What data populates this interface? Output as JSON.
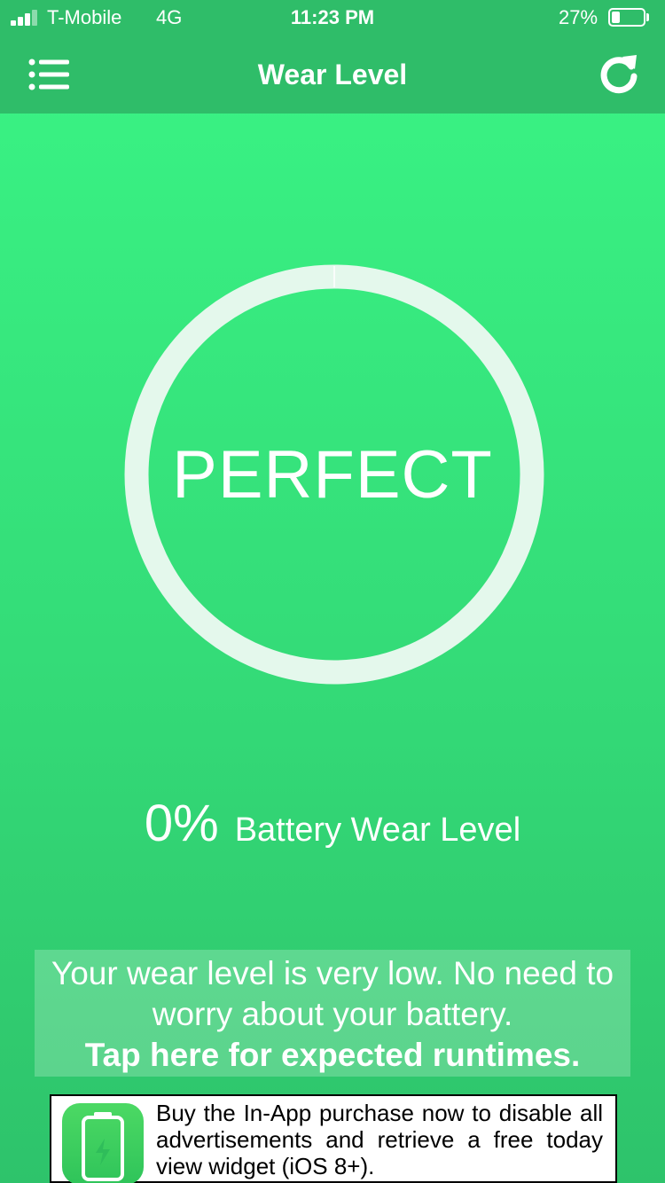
{
  "status_bar": {
    "carrier": "T-Mobile",
    "network": "4G",
    "time": "11:23 PM",
    "battery_percent": "27%",
    "battery_level": 0.27
  },
  "nav": {
    "title": "Wear Level",
    "menu_icon": "list-icon",
    "refresh_icon": "refresh-icon"
  },
  "gauge": {
    "status": "PERFECT",
    "wear_fraction": 0.0
  },
  "wear": {
    "value": "0%",
    "label": "Battery Wear Level"
  },
  "message": {
    "text": "Your wear level is very low. No need to worry about your battery.",
    "link": "Tap here for expected runtimes."
  },
  "ad": {
    "icon": "battery-bolt-icon",
    "text": "Buy the In-App purchase now to disable all advertisements and retrieve a free today view widget (iOS 8+)."
  },
  "colors": {
    "nav_bg": "#2fbd69",
    "body_top": "#3af585",
    "body_bottom": "#2ec36b",
    "ring": "#e4f8ec"
  }
}
